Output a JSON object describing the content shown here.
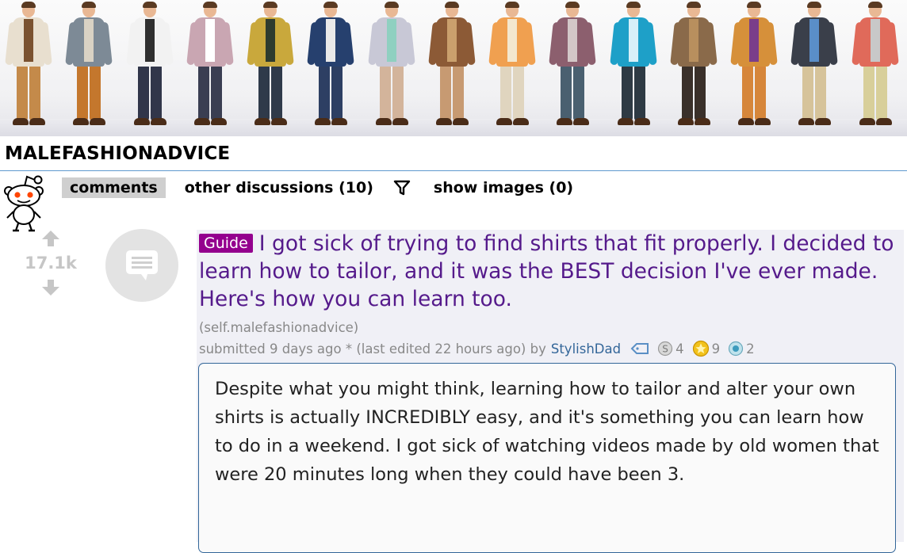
{
  "subreddit": {
    "name": "MALEFASHIONADVICE"
  },
  "banner_icon": "illustrated-menswear-figures-banner",
  "tabs": [
    {
      "label": "comments",
      "selected": true
    },
    {
      "label": "other discussions (10)",
      "selected": false
    },
    {
      "label": "show images (0)",
      "selected": false
    }
  ],
  "icons": {
    "filter": "filter-funnel-icon",
    "mascot": "reddit-alien-icon",
    "thumbnail": "self-post-text-icon"
  },
  "post": {
    "score": "17.1k",
    "flair": "Guide",
    "title": "I got sick of trying to find shirts that fit properly. I decided to learn how to tailor, and it was the BEST decision I've ever made. Here's how you can learn too.",
    "domain": "(self.malefashionadvice)",
    "submitted_prefix": "submitted",
    "submitted_time": "9 days ago",
    "edited_note": "* (last edited 22 hours ago)",
    "by_text": "by",
    "author": "StylishDad",
    "awards": [
      {
        "icon": "silver-award-icon",
        "count": "4",
        "color": "#c0c0c0"
      },
      {
        "icon": "gold-award-icon",
        "count": "9",
        "color": "#e6b800"
      },
      {
        "icon": "platinum-award-icon",
        "count": "2",
        "color": "#4aa3c9"
      }
    ],
    "body": "Despite what you might think, learning how to tailor and alter your own shirts is actually INCREDIBLY easy, and it's something you can learn how to do in a weekend. I got sick of watching videos made by old women that were 20 minutes long when they could have been 3."
  },
  "colors": {
    "title_link": "#551a8b",
    "flair_bg": "#94008e",
    "author_link": "#369",
    "score": "#c6c6c6",
    "header_rule": "#5f99cf"
  }
}
